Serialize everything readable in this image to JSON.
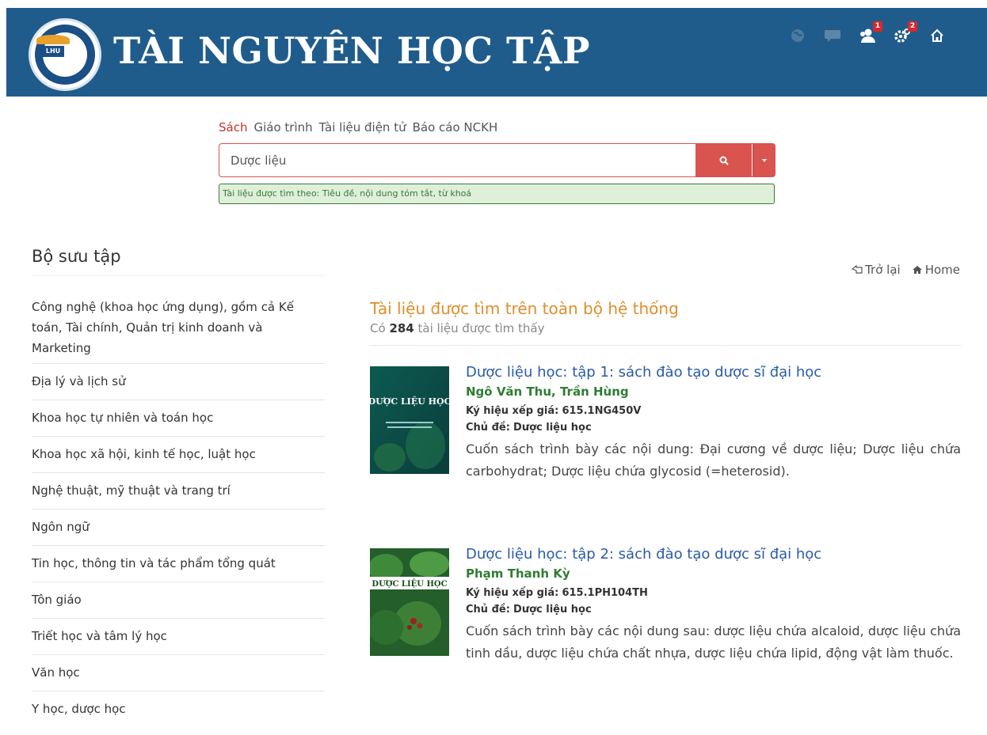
{
  "header": {
    "title": "TÀI NGUYÊN HỌC TẬP",
    "logo_text": "LHU",
    "icons": [
      {
        "name": "globe-icon",
        "badge": ""
      },
      {
        "name": "chat-icon",
        "badge": ""
      },
      {
        "name": "users-icon",
        "badge": "1"
      },
      {
        "name": "gears-icon",
        "badge": "2"
      },
      {
        "name": "home-icon",
        "badge": ""
      }
    ]
  },
  "search": {
    "tabs": [
      "Sách",
      "Giáo trình",
      "Tài liệu điện tử",
      "Báo cáo NCKH"
    ],
    "active_tab": "Sách",
    "value": "Dược liệu",
    "hint": "Tài liệu được tìm theo: Tiêu đề, nội dung tóm tắt, từ khoá"
  },
  "sidebar": {
    "title": "Bộ sưu tập",
    "items": [
      "Công nghệ (khoa học ứng dụng), gồm cả Kế toán, Tài chính, Quản trị kinh doanh và Marketing",
      "Địa lý và lịch sử",
      "Khoa học tự nhiên và toán học",
      "Khoa học xã hội, kinh tế học, luật học",
      "Nghệ thuật, mỹ thuật và trang trí",
      "Ngôn ngữ",
      "Tin học, thông tin và tác phẩm tổng quát",
      "Tôn giáo",
      "Triết học và tâm lý học",
      "Văn học",
      "Y học, dược học"
    ]
  },
  "nav": {
    "back": "Trở lại",
    "home": "Home"
  },
  "results": {
    "title": "Tài liệu được tìm trên toàn bộ hệ thống",
    "count_prefix": "Có",
    "count": "284",
    "count_suffix": "tài liệu được tìm thấy",
    "callno_label": "Ký hiệu xếp giá:",
    "subject_label": "Chủ đề:",
    "books": [
      {
        "title": "Dược liệu học: tập 1: sách đào tạo dược sĩ đại học",
        "author": "Ngô Văn Thu, Trần Hùng",
        "callno": "615.1NG450V",
        "subject": "Dược liệu học",
        "desc": "Cuốn sách trình bày các nội dung: Đại cương về dược liệu; Dược liệu chứa carbohydrat; Dược liệu chứa glycosid (=heterosid).",
        "cover_text": "DƯỢC LIỆU HỌC"
      },
      {
        "title": "Dược liệu học: tập 2: sách đào tạo dược sĩ đại học",
        "author": "Phạm Thanh Kỳ",
        "callno": "615.1PH104TH",
        "subject": "Dược liệu học",
        "desc": "Cuốn sách trình bày các nội dung sau: dược liệu chứa alcaloid, dược liệu chứa tinh dầu, dược liệu chứa chất nhựa, dược liệu chứa lipid, động vật làm thuốc.",
        "cover_text": "DƯỢC LIỆU HỌC"
      }
    ]
  }
}
